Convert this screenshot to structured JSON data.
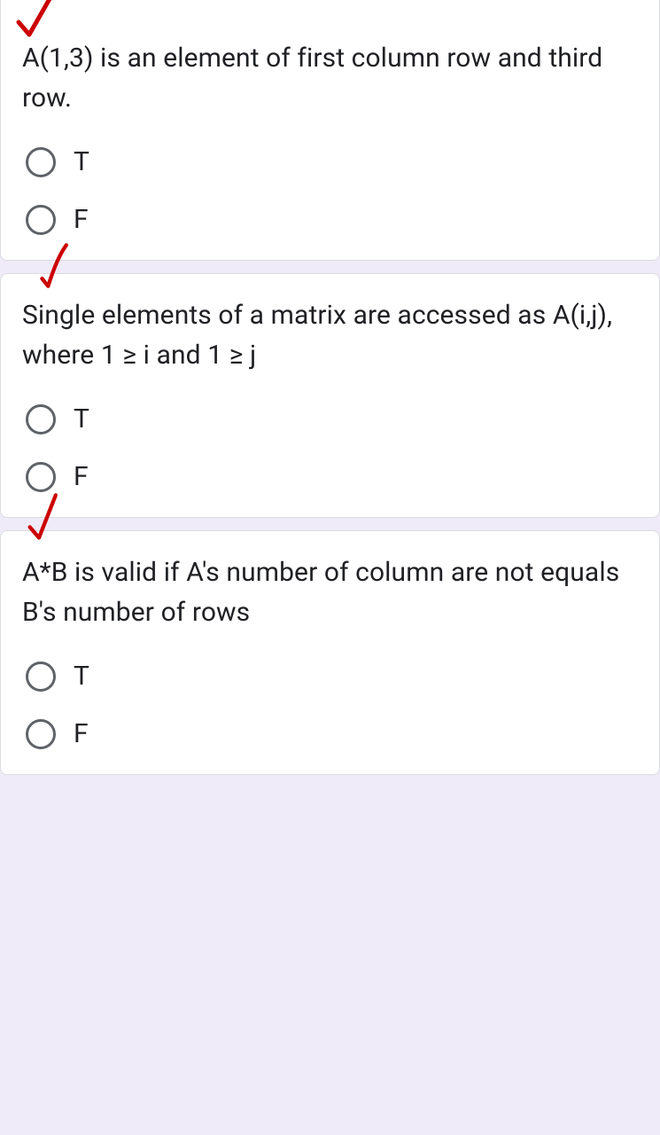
{
  "questions": [
    {
      "text": "A(1,3) is an element of first column row and third row.",
      "options": [
        "T",
        "F"
      ],
      "checkmark": true
    },
    {
      "text": "Single elements of a matrix are accessed as A(i,j), where 1 ≥ i and 1 ≥ j",
      "options": [
        "T",
        "F"
      ],
      "checkmark": true
    },
    {
      "text": "A*B is valid if A's number of column are not equals B's number of rows",
      "options": [
        "T",
        "F"
      ],
      "checkmark": true
    }
  ]
}
